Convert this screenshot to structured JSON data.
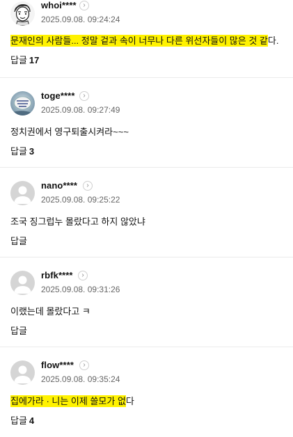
{
  "comments": [
    {
      "username": "whoi****",
      "datetime": "2025.09.08. 09:24:24",
      "text_highlighted": "문재인의 사람들... 정말 겉과 속이 너무나 다른 위선자들이 많은 것 같",
      "text_rest": "다.",
      "reply_label": "답글",
      "reply_count": "17",
      "avatar": "cartoon-face-avatar"
    },
    {
      "username": "toge****",
      "datetime": "2025.09.08. 09:27:49",
      "text_highlighted": "",
      "text_rest": "정치권에서 영구퇴출시켜라~~~",
      "reply_label": "답글",
      "reply_count": "3",
      "avatar": "blue-sticker-avatar"
    },
    {
      "username": "nano****",
      "datetime": "2025.09.08. 09:25:22",
      "text_highlighted": "",
      "text_rest": "조국 징그럽누 몰랐다고 하지 않았냐",
      "reply_label": "답글",
      "reply_count": "",
      "avatar": "default-avatar"
    },
    {
      "username": "rbfk****",
      "datetime": "2025.09.08. 09:31:26",
      "text_highlighted": "",
      "text_rest": "이랬는데 몰랐다고 ㅋ",
      "reply_label": "답글",
      "reply_count": "",
      "avatar": "default-avatar"
    },
    {
      "username": "flow****",
      "datetime": "2025.09.08. 09:35:24",
      "text_highlighted": "집에가라 · 니는 이제 쓸모가 없",
      "text_rest": "다",
      "reply_label": "답글",
      "reply_count": "4",
      "avatar": "default-avatar"
    }
  ],
  "colors": {
    "highlight": "#fff200",
    "divider": "#ebebeb",
    "date": "#666666",
    "default_avatar_bg": "#d5d5d5"
  },
  "icons": {
    "profile_button": "chevron-right-icon"
  }
}
